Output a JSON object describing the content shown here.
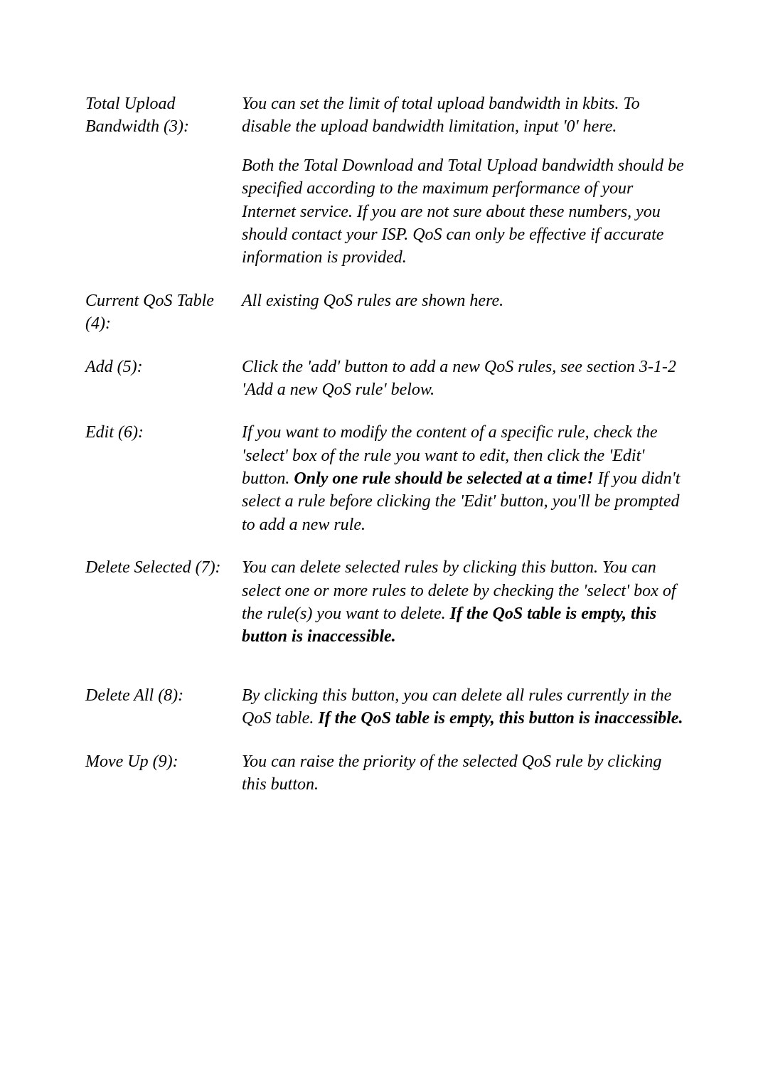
{
  "items": [
    {
      "term": "Total Upload Bandwidth (3):",
      "paras": [
        {
          "runs": [
            {
              "t": "You can set the limit of total upload bandwidth in kbits. To disable the upload bandwidth limitation, input '0' here."
            }
          ]
        },
        {
          "runs": [
            {
              "t": "Both the Total Download and Total Upload bandwidth should be specified according to the maximum performance of your Internet service. If you are not sure about these numbers, you should contact your ISP. QoS can only be effective if accurate information is provided."
            }
          ]
        }
      ]
    },
    {
      "term": "Current QoS Table (4):",
      "paras": [
        {
          "runs": [
            {
              "t": "All existing QoS rules are shown here."
            }
          ]
        }
      ]
    },
    {
      "term": "Add (5):",
      "paras": [
        {
          "runs": [
            {
              "t": "Click the 'add' button to add a new QoS rules, see section 3-1-2 'Add a new QoS rule' below."
            }
          ]
        }
      ]
    },
    {
      "term": "Edit (6):",
      "paras": [
        {
          "runs": [
            {
              "t": "If you want to modify the content of a specific rule, check the 'select' box of the rule you want to edit, then click the 'Edit' button. "
            },
            {
              "t": "Only one rule should be selected at a time!",
              "b": true
            },
            {
              "t": " If you didn't select a rule before clicking the 'Edit' button, you'll be prompted to add a new rule."
            }
          ]
        }
      ]
    },
    {
      "term": "Delete Selected (7):",
      "paras": [
        {
          "runs": [
            {
              "t": "You can delete selected rules by clicking this button. You can select one or more rules to delete by checking the 'select' box of the rule(s) you want to delete. "
            },
            {
              "t": "If the QoS table is empty, this button is inaccessible.",
              "b": true
            }
          ]
        }
      ],
      "extraGap": true
    },
    {
      "term": "Delete All (8):",
      "paras": [
        {
          "runs": [
            {
              "t": "By clicking this button, you can delete all rules currently in the QoS table. "
            },
            {
              "t": "If the QoS table is empty, this button is inaccessible.",
              "b": true
            }
          ]
        }
      ]
    },
    {
      "term": "Move Up (9):",
      "paras": [
        {
          "runs": [
            {
              "t": "You can raise the priority of the selected QoS rule by clicking this button."
            }
          ]
        }
      ]
    }
  ]
}
